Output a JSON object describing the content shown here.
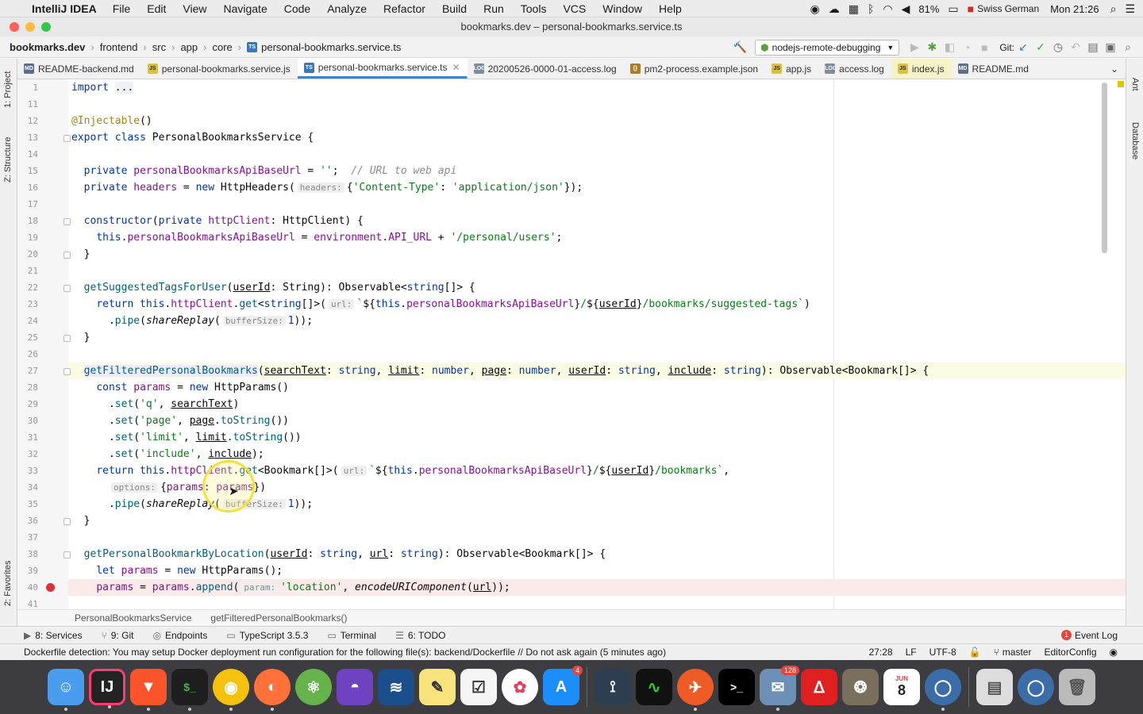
{
  "menubar": {
    "app": "IntelliJ IDEA",
    "items": [
      "File",
      "Edit",
      "View",
      "Navigate",
      "Code",
      "Analyze",
      "Refactor",
      "Build",
      "Run",
      "Tools",
      "VCS",
      "Window",
      "Help"
    ],
    "battery": "81%",
    "keyboard": "Swiss German",
    "clock": "Mon 21:26"
  },
  "window": {
    "title": "bookmarks.dev – personal-bookmarks.service.ts"
  },
  "nav": {
    "crumbs": [
      "bookmarks.dev",
      "frontend",
      "src",
      "app",
      "core",
      "personal-bookmarks.service.ts"
    ],
    "run_config": "nodejs-remote-debugging",
    "git_label": "Git:"
  },
  "tabs": [
    {
      "label": "README-backend.md",
      "type": "MD"
    },
    {
      "label": "personal-bookmarks.service.js",
      "type": "JS"
    },
    {
      "label": "personal-bookmarks.service.ts",
      "type": "TS"
    },
    {
      "label": "20200526-0000-01-access.log",
      "type": "LOG"
    },
    {
      "label": "pm2-process.example.json",
      "type": "JSON"
    },
    {
      "label": "app.js",
      "type": "JS"
    },
    {
      "label": "access.log",
      "type": "LOG"
    },
    {
      "label": "index.js",
      "type": "JS"
    },
    {
      "label": "README.md",
      "type": "MD"
    }
  ],
  "side": {
    "project": "1: Project",
    "structure": "Z: Structure",
    "favorites": "2: Favorites",
    "ant": "Ant",
    "database": "Database"
  },
  "line_numbers": [
    "1",
    "11",
    "12",
    "13",
    "14",
    "15",
    "16",
    "17",
    "18",
    "19",
    "20",
    "21",
    "22",
    "23",
    "24",
    "25",
    "26",
    "27",
    "28",
    "29",
    "30",
    "31",
    "32",
    "33",
    "34",
    "35",
    "36",
    "37",
    "38",
    "39",
    "40",
    "41"
  ],
  "hints": {
    "headers": "headers:",
    "url": "url:",
    "bufferSize": "bufferSize:",
    "options": "options:",
    "param": "param:"
  },
  "breadcrumb_bottom": [
    "PersonalBookmarksService",
    "getFilteredPersonalBookmarks()"
  ],
  "tool_windows": [
    "8: Services",
    "9: Git",
    "Endpoints",
    "TypeScript 3.5.3",
    "Terminal",
    "6: TODO"
  ],
  "event_log": "Event Log",
  "status": {
    "message": "Dockerfile detection: You may setup Docker deployment run configuration for the following file(s): backend/Dockerfile // Do not ask again (5 minutes ago)",
    "position": "27:28",
    "line_sep": "LF",
    "encoding": "UTF-8",
    "branch": "master",
    "editorconfig": "EditorConfig"
  },
  "dock": {
    "badges": {
      "appstore": "4",
      "mail": "128"
    },
    "calendar_month": "JUN",
    "calendar_day": "8"
  }
}
